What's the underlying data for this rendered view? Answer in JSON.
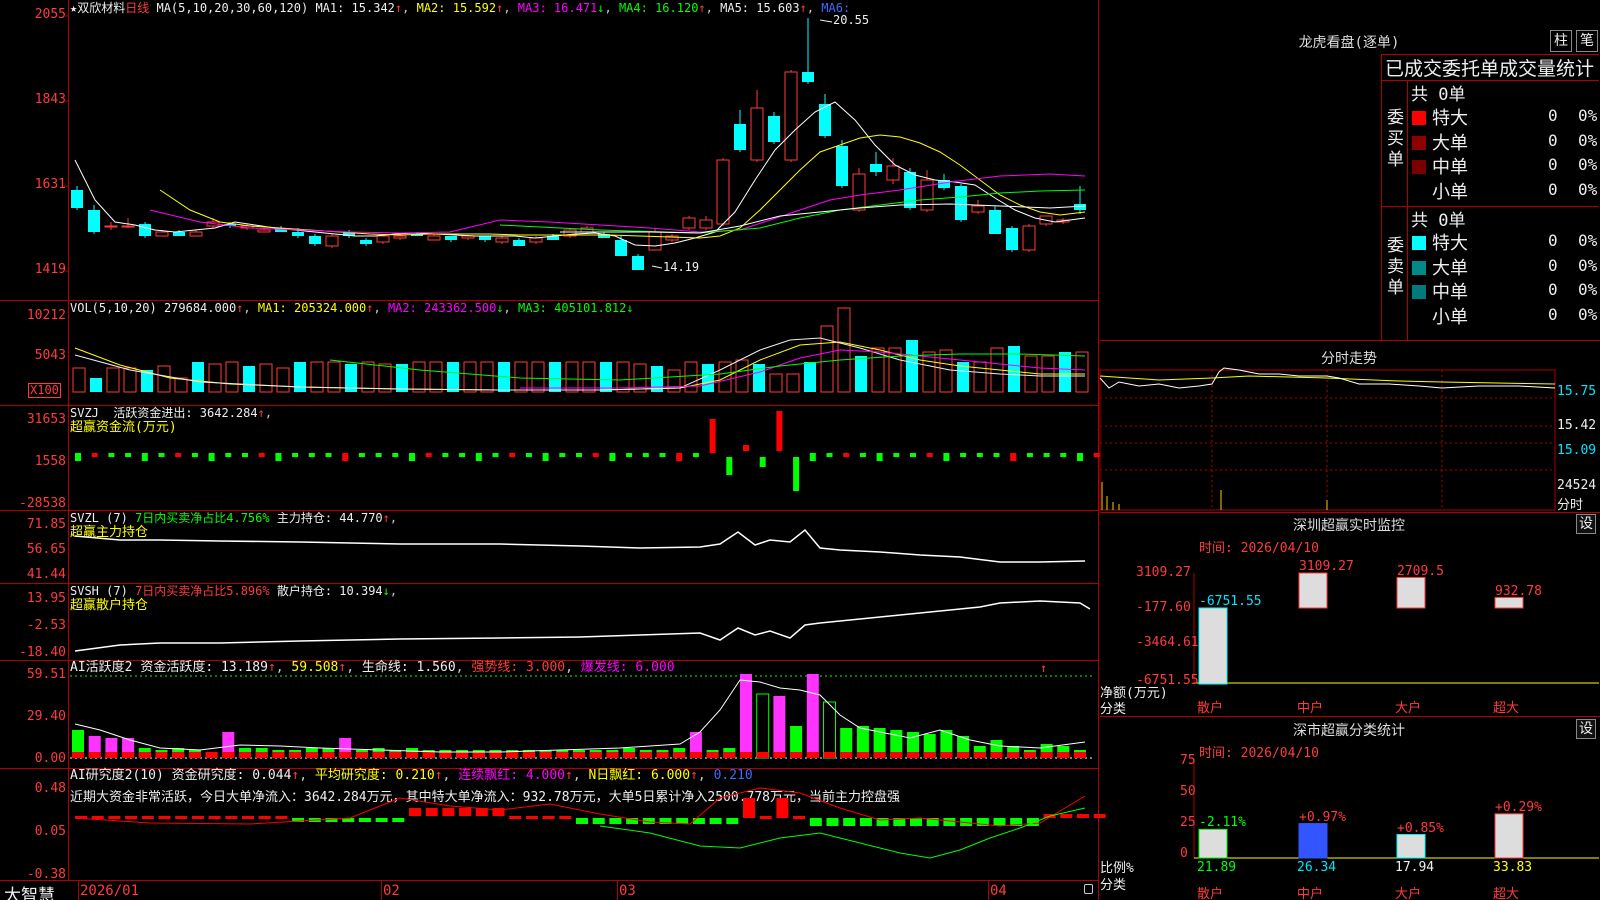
{
  "stock": {
    "title": "★双欣材料",
    "period": "日线"
  },
  "pane_main": {
    "ma_label": "MA(5,10,20,30,60,120)",
    "ma1": "MA1: 15.342",
    "ma2": "MA2: 15.592",
    "ma3": "MA3: 16.471",
    "ma4": "MA4: 16.120",
    "ma5": "MA5: 15.603",
    "ma6": "MA6:",
    "up": "↑",
    "down": "↓",
    "y_ticks": [
      "2055",
      "1843",
      "1631",
      "1419"
    ],
    "high_label": "20.55",
    "low_label": "14.19"
  },
  "pane_vol": {
    "label": "VOL(5,10,20)",
    "value": "279684.000",
    "ma1": "MA1: 205324.000",
    "ma2": "MA2: 243362.500",
    "ma3": "MA3: 405101.812",
    "y_ticks": [
      "10212",
      "5043"
    ],
    "unit": "X100"
  },
  "pane_svzj": {
    "label": "SVZJ",
    "desc": "活跃资金进出: 3642.284",
    "sub": "超赢资金流(万元)",
    "y_ticks": [
      "31653",
      "1558",
      "-28538"
    ]
  },
  "pane_svzl": {
    "label": "SVZL (7)",
    "desc_a": "7日内买卖净占比4.756%",
    "desc_b": "主力持仓: 44.770",
    "sub": "超赢主力持仓",
    "y_ticks": [
      "71.85",
      "56.65",
      "41.44"
    ]
  },
  "pane_svsh": {
    "label": "SVSH (7)",
    "desc_a": "7日内买卖净占比5.896%",
    "desc_b": "散户持仓: 10.394",
    "sub": "超赢散户持仓",
    "y_ticks": [
      "13.95",
      "-2.53",
      "-18.40"
    ]
  },
  "pane_ai2": {
    "label": "AI活跃度2",
    "a": "资金活跃度: 13.189",
    "b": "59.508",
    "c": "生命线: 1.560",
    "d": "强势线: 3.000",
    "e": "爆发线: 6.000",
    "y_ticks": [
      "59.51",
      "29.40",
      "0.00"
    ]
  },
  "pane_ai_study": {
    "label": "AI研究度2(10)",
    "a": "资金研究度: 0.044",
    "b": "平均研究度: 0.210",
    "c": "连续飘红: 4.000",
    "d": "N日飘红: 6.000",
    "e": "0.210",
    "comment": "近期大资金非常活跃，今日大单净流入：3642.284万元，其中特大单净流入：932.78万元，大单5日累计净入2500.778万元，当前主力控盘强",
    "y_ticks": [
      "0.48",
      "0.05",
      "-0.38"
    ]
  },
  "bottom": {
    "brand": "大智慧",
    "dates": [
      "2026/01",
      "02",
      "03",
      "04"
    ]
  },
  "right": {
    "lhb_title": "龙虎看盘(逐单)",
    "btn_zhu": "柱",
    "btn_bi": "笔",
    "stat_title": "已成交委托单成交量统计",
    "buy_label": "委买单",
    "sell_label": "委卖单",
    "buy_total": "共 0单",
    "sell_total": "共 0单",
    "rows": [
      "特大",
      "大单",
      "中单",
      "小单"
    ],
    "zero": "0",
    "pct": "0%",
    "colors": {
      "buy": [
        "#ff0000",
        "#8b0000",
        "#7a0000",
        "#000000"
      ],
      "sell": [
        "#00ffff",
        "#008b8b",
        "#007a7a",
        "#000000"
      ]
    },
    "fenshi_title": "分时走势",
    "fenshi_y": [
      "15.75",
      "15.42",
      "15.09",
      "24524",
      "分时"
    ],
    "sz_title": "深圳超赢实时监控",
    "sz_btn": "设",
    "sz_time": "时间: 2026/04/10",
    "sz_y": [
      "3109.27",
      "-177.60",
      "-3464.61",
      "-6751.55"
    ],
    "sz_unit": "净额(万元)",
    "sz_cat_label": "分类",
    "sz_cats": [
      "散户",
      "中户",
      "大户",
      "超大"
    ],
    "sz_vals": [
      "-6751.55",
      "3109.27",
      "2709.5",
      "932.78"
    ],
    "sc_title": "深市超赢分类统计",
    "sc_btn": "设",
    "sc_time": "时间: 2026/04/10",
    "sc_y": [
      "75",
      "50",
      "25",
      "0"
    ],
    "sc_unit": "比例%",
    "sc_cat_label": "分类",
    "sc_cats": [
      "散户",
      "中户",
      "大户",
      "超大"
    ],
    "sc_top": [
      "-2.11%",
      "+0.97%",
      "+0.85%",
      "+0.29%"
    ],
    "sc_vals": [
      "21.89",
      "26.34",
      "17.94",
      "33.83"
    ]
  }
}
